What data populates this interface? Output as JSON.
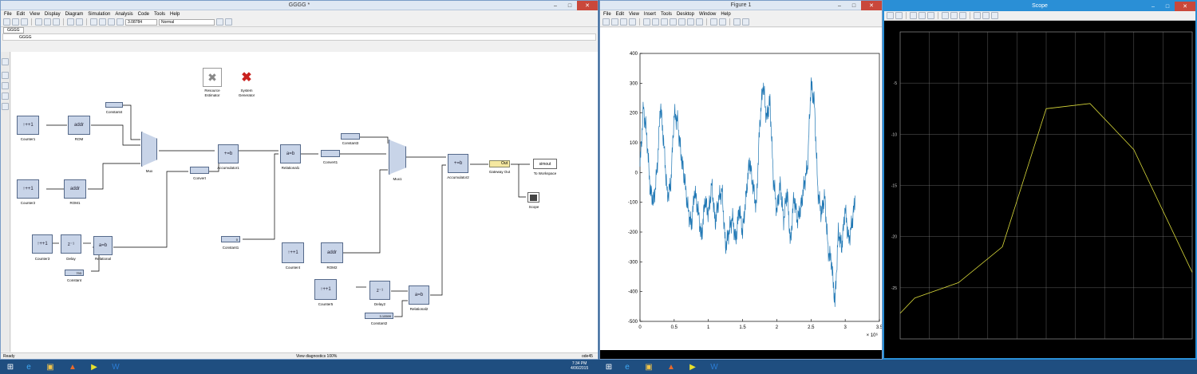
{
  "simulink": {
    "title": "GGGG *",
    "menu": [
      "File",
      "Edit",
      "View",
      "Display",
      "Diagram",
      "Simulation",
      "Analysis",
      "Code",
      "Tools",
      "Help"
    ],
    "sim_time": "3.08784",
    "sim_mode": "Normal",
    "tab": "GGGG",
    "breadcrumb": "GGGG",
    "status_left": "Ready",
    "status_center": "View diagnostics  100%",
    "status_right": "ode45",
    "xilinx": {
      "resource_estimator": "Resource\nEstimator",
      "system_generator": "System\nGenerator"
    },
    "blocks": {
      "counter1": "Counter1",
      "rom": "ROM",
      "constant4": "Constant4",
      "mux": "Mux",
      "counter2": "Counter2",
      "rom1": "ROM1",
      "convert": "Convert",
      "accumulator1": "Accumulator1",
      "relational1": "Relational1",
      "convert1": "Convert1",
      "constant3": "Constant3",
      "mux1": "Mux1",
      "accumulator2": "Accumulator2",
      "gateway_out": "Gateway Out",
      "gateway_out_icon": "Out",
      "to_workspace": "To Workspace",
      "to_workspace_icon": "simout",
      "scope": "Scope",
      "counter3": "Counter3",
      "delay": "Delay",
      "relational": "Relational",
      "constant": "Constant",
      "constant_val": "793",
      "constant1": "Constant1",
      "constant1_val": "0",
      "counter4": "Counter4",
      "rom2": "ROM2",
      "counter5": "Counter5",
      "delay2": "Delay2",
      "relational2": "Relational2",
      "constant2": "Constant2",
      "constant2_val": "3.10599"
    }
  },
  "figure": {
    "title": "Figure 1",
    "menu": [
      "File",
      "Edit",
      "View",
      "Insert",
      "Tools",
      "Desktop",
      "Window",
      "Help"
    ],
    "exponent": "× 10⁶"
  },
  "scope": {
    "title": "Scope"
  },
  "taskbar": {
    "time": "7:34 PM",
    "date": "4/06/2015"
  },
  "chart_data": [
    {
      "type": "line",
      "title": "",
      "xlim": [
        0,
        3.5
      ],
      "ylim": [
        -500,
        400
      ],
      "x_ticks": [
        "0",
        "0.5",
        "1",
        "1.5",
        "2",
        "2.5",
        "3",
        "3.5"
      ],
      "y_ticks": [
        "400",
        "300",
        "200",
        "100",
        "0",
        "-100",
        "-200",
        "-300",
        "-400",
        "-500"
      ],
      "x_exponent_label": "× 10⁶",
      "series": [
        {
          "color": "#1f77b4",
          "x": [
            0,
            0.05,
            0.1,
            0.15,
            0.2,
            0.25,
            0.3,
            0.35,
            0.4,
            0.45,
            0.5,
            0.55,
            0.6,
            0.65,
            0.7,
            0.75,
            0.8,
            0.85,
            0.9,
            0.95,
            1.0,
            1.05,
            1.1,
            1.15,
            1.2,
            1.25,
            1.3,
            1.35,
            1.4,
            1.45,
            1.5,
            1.55,
            1.6,
            1.65,
            1.7,
            1.75,
            1.8,
            1.85,
            1.9,
            1.95,
            2.0,
            2.05,
            2.1,
            2.15,
            2.2,
            2.25,
            2.3,
            2.35,
            2.4,
            2.45,
            2.5,
            2.55,
            2.6,
            2.65,
            2.7,
            2.75,
            2.8,
            2.85,
            2.9,
            2.95,
            3.0,
            3.05,
            3.1,
            3.15
          ],
          "y": [
            20,
            220,
            120,
            -60,
            -100,
            10,
            230,
            90,
            -80,
            -40,
            200,
            170,
            60,
            -20,
            -120,
            -180,
            -60,
            -130,
            -220,
            -90,
            -140,
            -40,
            -170,
            -90,
            -60,
            -250,
            -200,
            -150,
            -230,
            -120,
            -200,
            -80,
            40,
            -40,
            -120,
            160,
            300,
            180,
            240,
            -20,
            -130,
            -40,
            -160,
            -60,
            -240,
            -80,
            -160,
            -120,
            -40,
            20,
            300,
            230,
            -60,
            -140,
            -80,
            -260,
            -300,
            -440,
            -200,
            -250,
            -120,
            -230,
            -170,
            -80
          ]
        }
      ]
    },
    {
      "type": "line",
      "title": "",
      "xlim": [
        0,
        10
      ],
      "ylim": [
        -30,
        0
      ],
      "y_ticks": [
        "-5",
        "-10",
        "-15",
        "-20",
        "-25"
      ],
      "x_ticks": [],
      "grid": true,
      "background": "#000000",
      "series": [
        {
          "color": "#d8d83a",
          "x": [
            0,
            0.5,
            2,
            3.5,
            5,
            6.5,
            8,
            10
          ],
          "y": [
            -27.5,
            -26,
            -24.5,
            -21,
            -7.5,
            -7,
            -11.5,
            -23.5
          ]
        }
      ]
    }
  ]
}
